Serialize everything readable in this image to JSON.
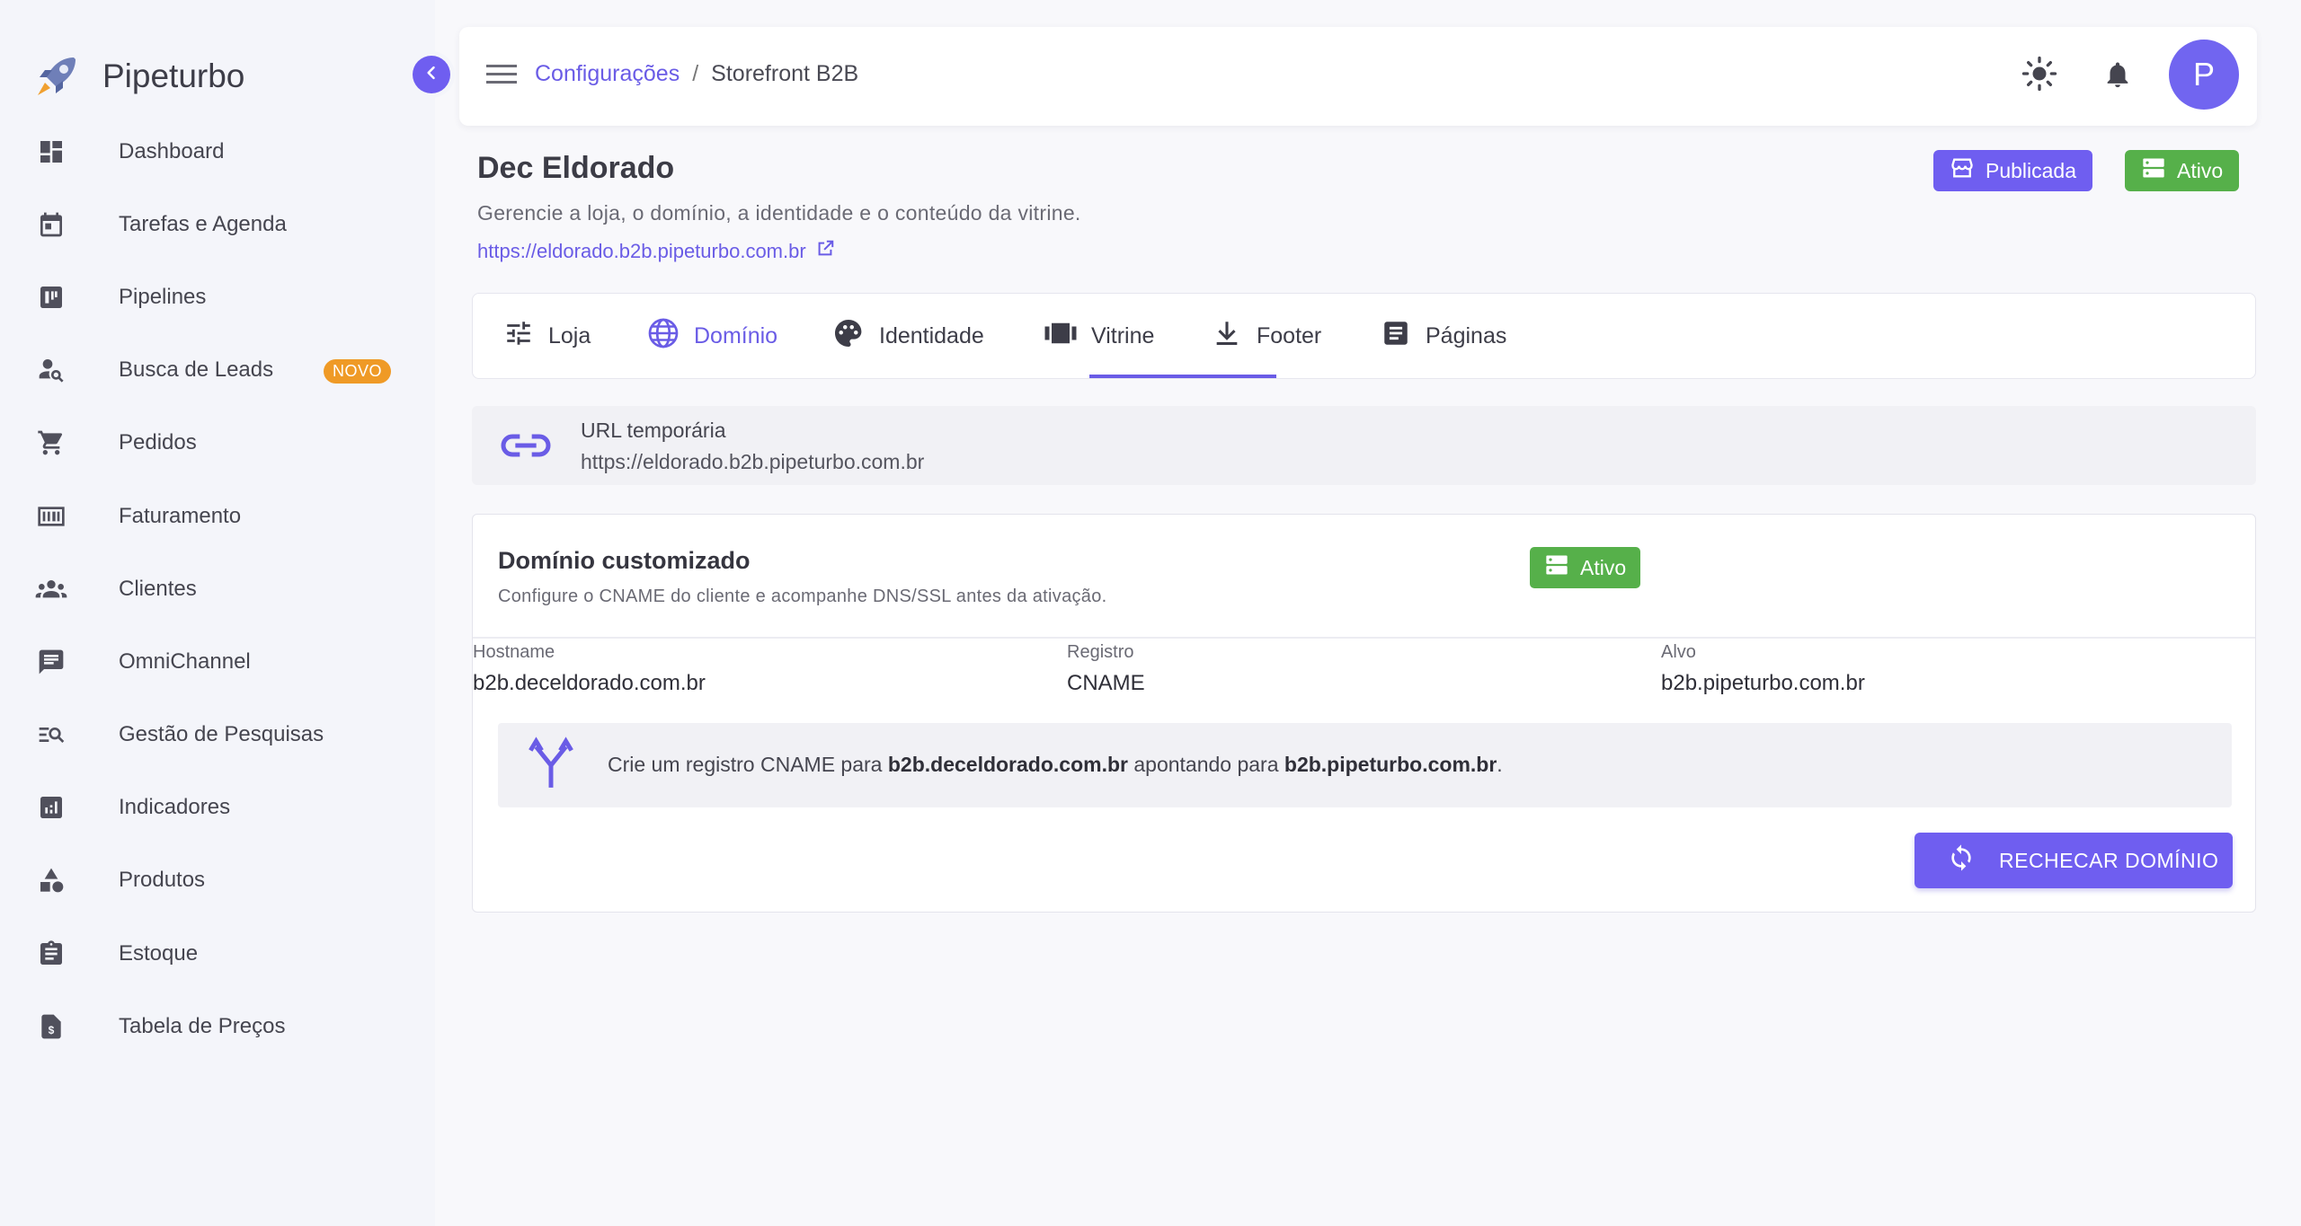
{
  "brand": {
    "name": "Pipeturbo"
  },
  "sidebar": {
    "items": [
      {
        "label": "Dashboard",
        "icon": "dashboard-icon"
      },
      {
        "label": "Tarefas e Agenda",
        "icon": "calendar-icon"
      },
      {
        "label": "Pipelines",
        "icon": "kanban-icon"
      },
      {
        "label": "Busca de Leads",
        "icon": "person-search-icon",
        "badge": "NOVO"
      },
      {
        "label": "Pedidos",
        "icon": "cart-icon"
      },
      {
        "label": "Faturamento",
        "icon": "billing-icon"
      },
      {
        "label": "Clientes",
        "icon": "people-icon"
      },
      {
        "label": "OmniChannel",
        "icon": "chat-icon"
      },
      {
        "label": "Gestão de Pesquisas",
        "icon": "survey-search-icon"
      },
      {
        "label": "Indicadores",
        "icon": "analytics-icon"
      },
      {
        "label": "Produtos",
        "icon": "category-icon"
      },
      {
        "label": "Estoque",
        "icon": "clipboard-icon"
      },
      {
        "label": "Tabela de Preços",
        "icon": "price-doc-icon"
      }
    ]
  },
  "header": {
    "breadcrumb_link": "Configurações",
    "breadcrumb_sep": "/",
    "breadcrumb_current": "Storefront B2B",
    "avatar_initial": "P"
  },
  "store": {
    "title": "Dec Eldorado",
    "description": "Gerencie a loja, o domínio, a identidade e o conteúdo da vitrine.",
    "url": "https://eldorado.b2b.pipeturbo.com.br",
    "published_label": "Publicada",
    "active_label": "Ativo"
  },
  "tabs": [
    {
      "label": "Loja",
      "icon": "tune-icon"
    },
    {
      "label": "Domínio",
      "icon": "globe-icon",
      "active": true
    },
    {
      "label": "Identidade",
      "icon": "palette-icon"
    },
    {
      "label": "Vitrine",
      "icon": "carousel-icon"
    },
    {
      "label": "Footer",
      "icon": "download-icon"
    },
    {
      "label": "Páginas",
      "icon": "article-icon"
    }
  ],
  "temp_url": {
    "title": "URL temporária",
    "value": "https://eldorado.b2b.pipeturbo.com.br"
  },
  "custom_domain": {
    "title": "Domínio customizado",
    "description": "Configure o CNAME do cliente e acompanhe DNS/SSL antes da ativação.",
    "status": "Ativo",
    "columns": [
      {
        "header": "Hostname",
        "value": "b2b.deceldorado.com.br"
      },
      {
        "header": "Registro",
        "value": "CNAME"
      },
      {
        "header": "Alvo",
        "value": "b2b.pipeturbo.com.br"
      }
    ],
    "info_prefix": "Crie um registro CNAME para",
    "info_host": "b2b.deceldorado.com.br",
    "info_middle": "apontando para",
    "info_target": "b2b.pipeturbo.com.br",
    "info_suffix": ".",
    "recheck_label": "RECHECAR DOMÍNIO"
  },
  "colors": {
    "accent": "#6f5ef0",
    "success": "#56b04a",
    "badge": "#ef9a26"
  }
}
